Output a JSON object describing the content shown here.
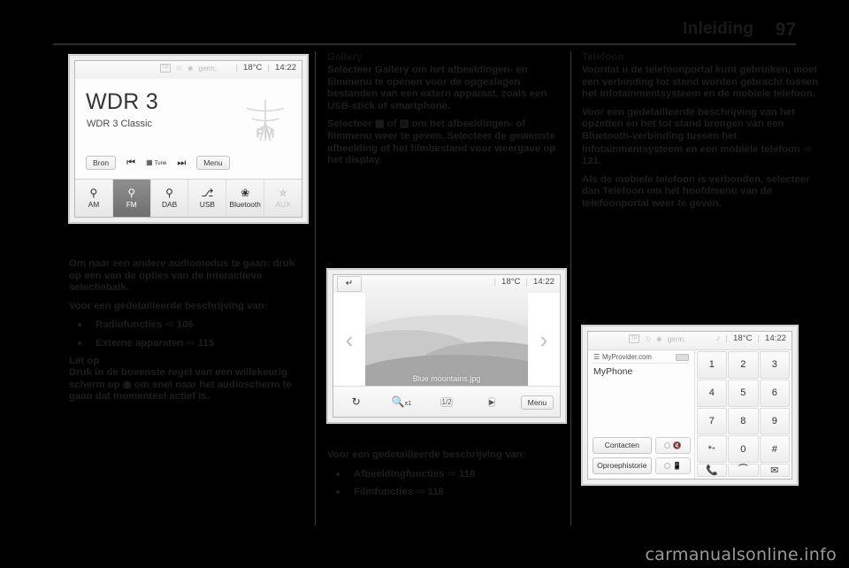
{
  "header": {
    "title": "Inleiding",
    "page_number": "97"
  },
  "watermark": "carmanualsonline.info",
  "radio_screen": {
    "status": {
      "tp": "TP",
      "rds_icon": "rds-icon",
      "bluetooth_icon": "bluetooth-icon",
      "mute_icon": "mute-icon",
      "temperature": "18°C",
      "time": "14:22",
      "separator": "|"
    },
    "station": "WDR 3",
    "station_info": "WDR 3 Classic",
    "source_button": "Bron",
    "prev_icon": "previous-track-icon",
    "tune_label": "Tune",
    "next_icon": "next-track-icon",
    "menu_button": "Menu",
    "band_logo": "FM",
    "tabs": [
      {
        "label": "AM",
        "icon": "antenna-icon",
        "state": "normal"
      },
      {
        "label": "FM",
        "icon": "antenna-icon",
        "state": "active"
      },
      {
        "label": "DAB",
        "icon": "antenna-icon",
        "state": "normal"
      },
      {
        "label": "USB",
        "icon": "usb-icon",
        "state": "normal"
      },
      {
        "label": "Bluetooth",
        "icon": "bluetooth-icon",
        "state": "normal"
      },
      {
        "label": "AUX",
        "icon": "aux-jack-icon",
        "state": "disabled"
      }
    ]
  },
  "gallery_screen": {
    "back_icon": "back-arrow-icon",
    "temperature": "18°C",
    "time": "14:22",
    "prev_image_icon": "chevron-left-icon",
    "next_image_icon": "chevron-right-icon",
    "file_name": "Blue mountains.jpg",
    "toolbar": {
      "rotate_icon": "rotate-icon",
      "zoom_label": "x1",
      "zoom_icon": "magnifier-icon",
      "fit_label": "1/2",
      "slideshow_icon": "slideshow-icon",
      "menu_button": "Menu"
    }
  },
  "phone_screen": {
    "status": {
      "tp": "TP",
      "rds_icon": "rds-icon",
      "bluetooth_icon": "bluetooth-icon",
      "mute_icon": "mute-icon",
      "media_icon": "music-note-icon",
      "temperature": "18°C",
      "time": "14:22",
      "separator": "|"
    },
    "signal_icon": "signal-strength-icon",
    "provider": "MyProvider.com",
    "battery_icon": "battery-icon",
    "device_name": "MyPhone",
    "contacts_button": "Contacten",
    "call_history_button": "Oproephistorie",
    "mute_toggle_icon": "microphone-mute-icon",
    "speaker_toggle_icon": "handset-speaker-icon",
    "keys": [
      "1",
      "2",
      "3",
      "4",
      "5",
      "6",
      "7",
      "8",
      "9",
      "*",
      "0",
      "#"
    ],
    "star_sub": "+",
    "call_icon": "handset-call-icon",
    "hangup_icon": "handset-end-icon",
    "voicemail_icon": "voicemail-icon"
  },
  "column_left": {
    "paragraph_1": "Om naar een andere audiomodus te gaan: druk op een van de opties van de interactieve selectiebalk.",
    "paragraph_2": "Voor een gedetailleerde beschrijving van:",
    "bullets": [
      {
        "label": "Radiofuncties",
        "arrow": "⇨",
        "page": "106"
      },
      {
        "label": "Externe apparaten",
        "arrow": "⇨",
        "page": "115"
      }
    ],
    "note_title": "Let op",
    "note_text_1": "Druk in de bovenste regel van een willekeurig scherm op ",
    "note_icon": "home-circle-icon",
    "note_text_2": " om snel naar het audioscherm te gaan dat momenteel actief is."
  },
  "column_middle": {
    "heading": "Gallery",
    "paragraph_1_a": "Selecteer ",
    "paragraph_1_bold": "Gallery",
    "paragraph_1_b": " om het afbeeldingen- en filmmenu te openen voor de opgeslagen bestanden van een extern apparaat, zoals een USB-stick of smartphone.",
    "paragraph_2_a": "Selecteer ",
    "paragraph_2_icon_1": "image-grid-icon",
    "paragraph_2_mid": " of ",
    "paragraph_2_icon_2": "film-grid-icon",
    "paragraph_2_b": " om het afbeeldingen- of filmmenu weer te geven. Selecteer de gewenste afbeelding of het filmbestand voor weergave op het display.",
    "paragraph_3": "Voor een gedetailleerde beschrijving van:",
    "bullets": [
      {
        "label": "Afbeeldingfuncties",
        "arrow": "⇨",
        "page": "118"
      },
      {
        "label": "Filmfuncties",
        "arrow": "⇨",
        "page": "118"
      }
    ]
  },
  "column_right": {
    "heading": "Telefoon",
    "paragraph_1": "Voordat u de telefoonportal kunt gebruiken, moet een verbinding tot stand worden gebracht tussen het Infotainmentsysteem en de mobiele telefoon.",
    "paragraph_2": "Voor een gedetailleerde beschrijving van het opzetten en het tot stand brengen van een Bluetooth-verbinding tussen het Infotainmentsysteem en een mobiele telefoon ",
    "paragraph_2_arrow": "⇨",
    "paragraph_2_page": "121.",
    "paragraph_3_a": "Als de mobiele telefoon is verbonden, selecteer dan ",
    "paragraph_3_bold": "Telefoon",
    "paragraph_3_b": " om het hoofdmenu van de telefoonportal weer te geven."
  }
}
